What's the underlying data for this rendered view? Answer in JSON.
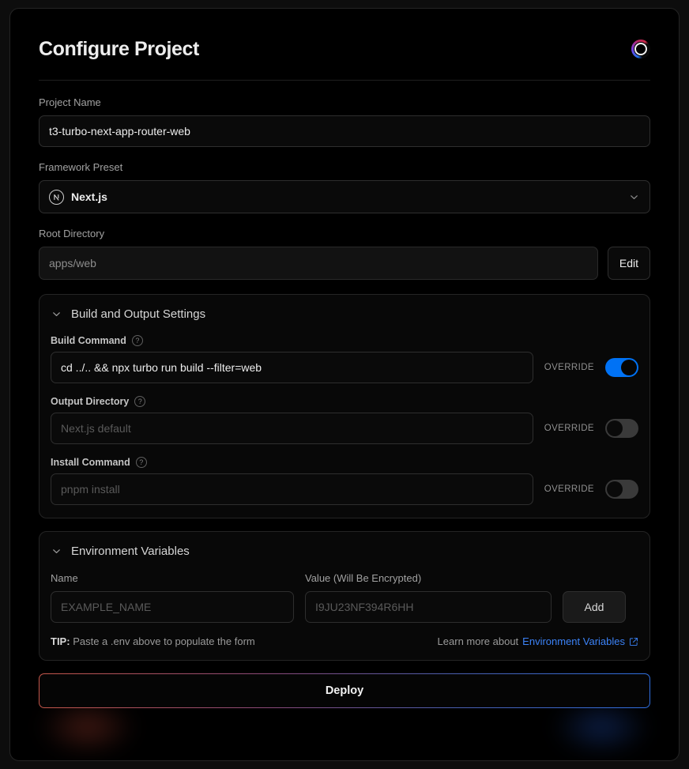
{
  "header": {
    "title": "Configure Project",
    "spinner_icon": "loading-ring-icon"
  },
  "project_name": {
    "label": "Project Name",
    "value": "t3-turbo-next-app-router-web"
  },
  "framework_preset": {
    "label": "Framework Preset",
    "value": "Next.js",
    "logo_icon": "nextjs-logo-icon",
    "chevron_icon": "chevron-down-icon"
  },
  "root_directory": {
    "label": "Root Directory",
    "value": "apps/web",
    "edit_label": "Edit"
  },
  "build_output": {
    "title": "Build and Output Settings",
    "chevron_icon": "chevron-down-icon",
    "override_label": "OVERRIDE",
    "help_icon": "question-mark-icon",
    "fields": [
      {
        "label": "Build Command",
        "value": "cd ../.. && npx turbo run build --filter=web",
        "placeholder": "",
        "override_on": true
      },
      {
        "label": "Output Directory",
        "value": "",
        "placeholder": "Next.js default",
        "override_on": false
      },
      {
        "label": "Install Command",
        "value": "",
        "placeholder": "pnpm install",
        "override_on": false
      }
    ]
  },
  "environment_variables": {
    "title": "Environment Variables",
    "chevron_icon": "chevron-down-icon",
    "name_label": "Name",
    "name_placeholder": "EXAMPLE_NAME",
    "value_label": "Value (Will Be Encrypted)",
    "value_placeholder": "I9JU23NF394R6HH",
    "add_label": "Add",
    "tip_prefix": "TIP:",
    "tip_text": "Paste a .env above to populate the form",
    "learn_prefix": "Learn more about",
    "learn_link": "Environment Variables",
    "external_icon": "external-link-icon"
  },
  "deploy": {
    "label": "Deploy"
  },
  "colors": {
    "accent_blue": "#0072f5",
    "link_blue": "#3b82f6",
    "page_bg": "#0d0d0d",
    "card_bg": "#000000"
  }
}
